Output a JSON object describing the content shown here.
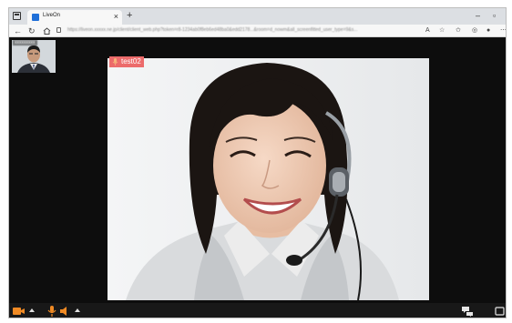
{
  "browser": {
    "tab_title": "LiveOn",
    "tab_close": "×",
    "new_tab": "+",
    "minimize": "–",
    "maximize": "▫",
    "url": "https://liveon.xxxxx.ne.jp/client/client_web.php?token=r8-1234ab0f8eb6ed48ba0&edd2178...&room=d_nowm&all_screenfitted_user_type=9&s..."
  },
  "conference": {
    "self_name": "xxxxxxxxx",
    "speaker_name": "test02"
  },
  "colors": {
    "accent_orange": "#f08a24",
    "speaker_tag": "#ec6b6b",
    "toolbar_bg": "#181818"
  }
}
